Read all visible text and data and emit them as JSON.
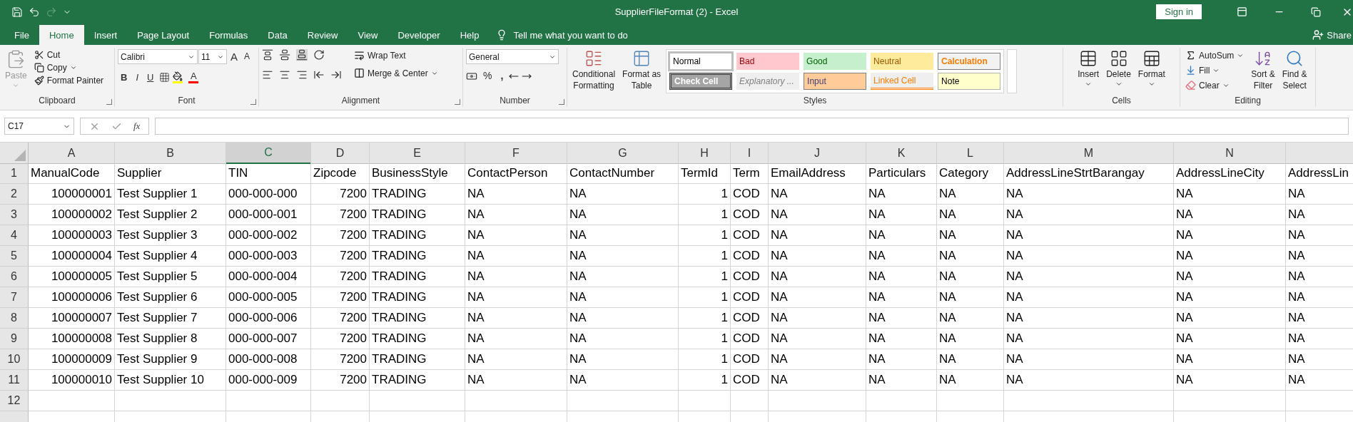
{
  "title_bar": {
    "title": "SupplierFileFormat (2)  -  Excel",
    "sign_in": "Sign in",
    "redo_disabled": true
  },
  "menu_tabs": [
    {
      "label": "File",
      "selected": false
    },
    {
      "label": "Home",
      "selected": true
    },
    {
      "label": "Insert",
      "selected": false
    },
    {
      "label": "Page Layout",
      "selected": false
    },
    {
      "label": "Formulas",
      "selected": false
    },
    {
      "label": "Data",
      "selected": false
    },
    {
      "label": "Review",
      "selected": false
    },
    {
      "label": "View",
      "selected": false
    },
    {
      "label": "Developer",
      "selected": false
    },
    {
      "label": "Help",
      "selected": false
    }
  ],
  "tell_me": "Tell me what you want to do",
  "share": "Share",
  "ribbon": {
    "clipboard": {
      "paste": {
        "label": "Paste",
        "disabled": true
      },
      "cut": "Cut",
      "copy": "Copy",
      "format_painter": "Format Painter",
      "label": "Clipboard"
    },
    "font": {
      "name": "Calibri",
      "size": "11",
      "grow": "A",
      "shrink": "A",
      "bold": "B",
      "italic": "I",
      "underline": "U",
      "font_color": "A",
      "label": "Font"
    },
    "alignment": {
      "wrap_text": "Wrap Text",
      "merge_center": "Merge & Center",
      "label": "Alignment"
    },
    "number": {
      "format": "General",
      "percent": "%",
      "comma": ",",
      "label": "Number"
    },
    "styles": {
      "conditional": [
        "Conditional",
        "Formatting"
      ],
      "format_table": [
        "Format as",
        "Table"
      ],
      "label": "Styles",
      "gallery": [
        {
          "label": "Normal",
          "kind": "normal",
          "selected": true
        },
        {
          "label": "Bad",
          "kind": "bad",
          "selected": false
        },
        {
          "label": "Good",
          "kind": "good",
          "selected": false
        },
        {
          "label": "Neutral",
          "kind": "neutral",
          "selected": false
        },
        {
          "label": "Calculation",
          "kind": "calculation",
          "selected": false
        },
        {
          "label": "Check Cell",
          "kind": "check",
          "selected": false
        },
        {
          "label": "Explanatory ...",
          "kind": "explanatory",
          "selected": false
        },
        {
          "label": "Input",
          "kind": "input",
          "selected": false
        },
        {
          "label": "Linked Cell",
          "kind": "linked",
          "selected": false
        },
        {
          "label": "Note",
          "kind": "note",
          "selected": false
        }
      ]
    },
    "cells": {
      "insert": "Insert",
      "delete": "Delete",
      "format": "Format",
      "label": "Cells"
    },
    "editing": {
      "autosum": "AutoSum",
      "fill": "Fill",
      "clear": "Clear",
      "sort": [
        "Sort &",
        "Filter"
      ],
      "find": [
        "Find &",
        "Select"
      ],
      "label": "Editing"
    }
  },
  "formula_bar": {
    "name_box": "C17",
    "fx": "fx"
  },
  "table": {
    "columns": [
      {
        "letter": "A",
        "selected": false,
        "kind": "number"
      },
      {
        "letter": "B",
        "selected": false,
        "kind": "text"
      },
      {
        "letter": "C",
        "selected": true,
        "kind": "text"
      },
      {
        "letter": "D",
        "selected": false,
        "kind": "number"
      },
      {
        "letter": "E",
        "selected": false,
        "kind": "text"
      },
      {
        "letter": "F",
        "selected": false,
        "kind": "text"
      },
      {
        "letter": "G",
        "selected": false,
        "kind": "text"
      },
      {
        "letter": "H",
        "selected": false,
        "kind": "number"
      },
      {
        "letter": "I",
        "selected": false,
        "kind": "text"
      },
      {
        "letter": "J",
        "selected": false,
        "kind": "text"
      },
      {
        "letter": "K",
        "selected": false,
        "kind": "text"
      },
      {
        "letter": "L",
        "selected": false,
        "kind": "text"
      },
      {
        "letter": "M",
        "selected": false,
        "kind": "text"
      },
      {
        "letter": "N",
        "selected": false,
        "kind": "text"
      },
      {
        "selected": false,
        "kind": "text"
      }
    ],
    "rows": [
      {
        "number": "1",
        "kind": "labels",
        "cells": [
          "ManualCode",
          "Supplier",
          "TIN",
          "Zipcode",
          "BusinessStyle",
          "ContactPerson",
          "ContactNumber",
          "TermId",
          "Term",
          "EmailAddress",
          "Particulars",
          "Category",
          "AddressLineStrtBarangay",
          "AddressLineCity",
          "AddressLin"
        ]
      },
      {
        "number": "2",
        "kind": "data",
        "cells": [
          "100000001",
          "Test Supplier 1",
          "000-000-000",
          "7200",
          "TRADING",
          "NA",
          "NA",
          "1",
          "COD",
          "NA",
          "NA",
          "NA",
          "NA",
          "NA",
          "NA"
        ]
      },
      {
        "number": "3",
        "kind": "data",
        "cells": [
          "100000002",
          "Test Supplier 2",
          "000-000-001",
          "7200",
          "TRADING",
          "NA",
          "NA",
          "1",
          "COD",
          "NA",
          "NA",
          "NA",
          "NA",
          "NA",
          "NA"
        ]
      },
      {
        "number": "4",
        "kind": "data",
        "cells": [
          "100000003",
          "Test Supplier 3",
          "000-000-002",
          "7200",
          "TRADING",
          "NA",
          "NA",
          "1",
          "COD",
          "NA",
          "NA",
          "NA",
          "NA",
          "NA",
          "NA"
        ]
      },
      {
        "number": "5",
        "kind": "data",
        "cells": [
          "100000004",
          "Test Supplier 4",
          "000-000-003",
          "7200",
          "TRADING",
          "NA",
          "NA",
          "1",
          "COD",
          "NA",
          "NA",
          "NA",
          "NA",
          "NA",
          "NA"
        ]
      },
      {
        "number": "6",
        "kind": "data",
        "cells": [
          "100000005",
          "Test Supplier 5",
          "000-000-004",
          "7200",
          "TRADING",
          "NA",
          "NA",
          "1",
          "COD",
          "NA",
          "NA",
          "NA",
          "NA",
          "NA",
          "NA"
        ]
      },
      {
        "number": "7",
        "kind": "data",
        "cells": [
          "100000006",
          "Test Supplier 6",
          "000-000-005",
          "7200",
          "TRADING",
          "NA",
          "NA",
          "1",
          "COD",
          "NA",
          "NA",
          "NA",
          "NA",
          "NA",
          "NA"
        ]
      },
      {
        "number": "8",
        "kind": "data",
        "cells": [
          "100000007",
          "Test Supplier 7",
          "000-000-006",
          "7200",
          "TRADING",
          "NA",
          "NA",
          "1",
          "COD",
          "NA",
          "NA",
          "NA",
          "NA",
          "NA",
          "NA"
        ]
      },
      {
        "number": "9",
        "kind": "data",
        "cells": [
          "100000008",
          "Test Supplier 8",
          "000-000-007",
          "7200",
          "TRADING",
          "NA",
          "NA",
          "1",
          "COD",
          "NA",
          "NA",
          "NA",
          "NA",
          "NA",
          "NA"
        ]
      },
      {
        "number": "10",
        "kind": "data",
        "cells": [
          "100000009",
          "Test Supplier 9",
          "000-000-008",
          "7200",
          "TRADING",
          "NA",
          "NA",
          "1",
          "COD",
          "NA",
          "NA",
          "NA",
          "NA",
          "NA",
          "NA"
        ]
      },
      {
        "number": "11",
        "kind": "data",
        "cells": [
          "100000010",
          "Test Supplier 10",
          "000-000-009",
          "7200",
          "TRADING",
          "NA",
          "NA",
          "1",
          "COD",
          "NA",
          "NA",
          "NA",
          "NA",
          "NA",
          "NA"
        ]
      },
      {
        "number": "12",
        "kind": "empty"
      },
      {
        "kind": "empty"
      }
    ]
  }
}
